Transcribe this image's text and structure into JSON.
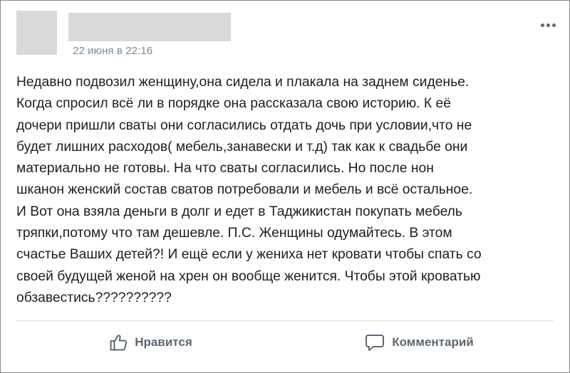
{
  "post": {
    "timestamp": "22 июня в 22:16",
    "body_lines": [
      "Недавно подвозил женщину,она сидела и плакала на заднем сиденье.",
      "Когда спросил всё ли в порядке она рассказала свою историю. К её",
      "дочери пришли сваты они согласились отдать дочь при условии,что не",
      "будет лишних расходов( мебель,занавески и т.д) так как к свадьбе они",
      "материально не готовы. На что сваты согласились. Но после нон",
      "шканон женский состав сватов потребовали и мебель и всё остальное.",
      "И Вот она взяла деньги в долг и едет в Таджикистан покупать мебель",
      "тряпки,потому что там дешевле. П.С. Женщины одумайтесь. В этом",
      "счастье Ваших детей?! И ещё если у жениха нет кровати чтобы спать со",
      "своей будущей женой на хрен он вообще женится. Чтобы этой кроватью",
      "обзавестись??????????"
    ]
  },
  "actions": {
    "like_label": "Нравится",
    "comment_label": "Комментарий"
  },
  "icons": {
    "more": "more-options-icon",
    "like": "thumbs-up-icon",
    "comment": "comment-bubble-icon"
  },
  "colors": {
    "text": "#1c1e21",
    "muted": "#606770",
    "timestamp": "#7f8793",
    "placeholder": "#d9d9d9"
  }
}
